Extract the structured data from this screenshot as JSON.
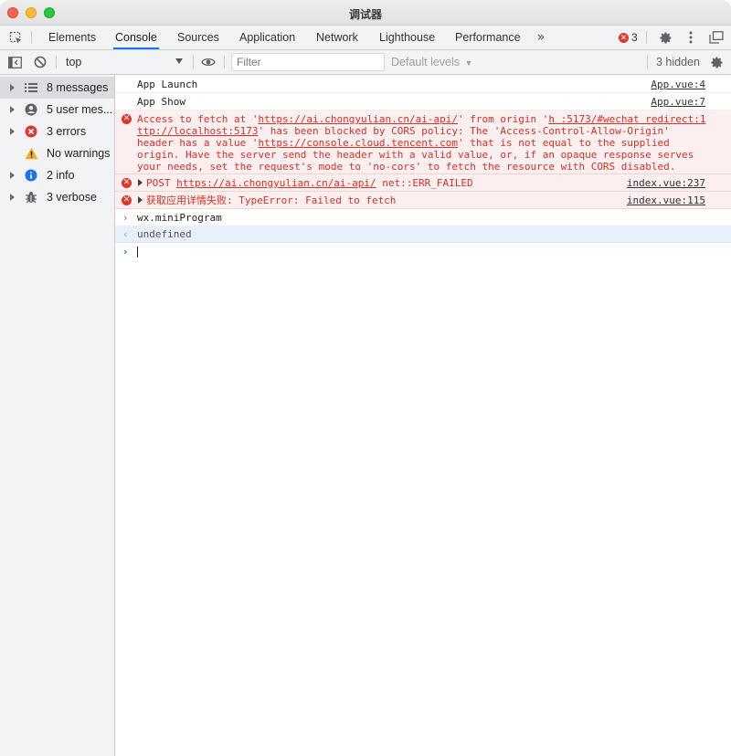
{
  "window": {
    "title": "调试器"
  },
  "tabs": {
    "items": [
      {
        "label": "Elements"
      },
      {
        "label": "Console"
      },
      {
        "label": "Sources"
      },
      {
        "label": "Application"
      },
      {
        "label": "Network"
      },
      {
        "label": "Lighthouse"
      },
      {
        "label": "Performance"
      }
    ],
    "active": "Console",
    "more_icon": "chevron-double-right-icon",
    "error_count": "3"
  },
  "toolbar": {
    "context": "top",
    "filter_placeholder": "Filter",
    "filter_value": "",
    "levels_label": "Default levels",
    "hidden_label": "3 hidden"
  },
  "sidebar": {
    "items": [
      {
        "label": "8 messages",
        "icon": "list-icon",
        "selected": true
      },
      {
        "label": "5 user mes...",
        "icon": "user-icon"
      },
      {
        "label": "3 errors",
        "icon": "error-icon"
      },
      {
        "label": "No warnings",
        "icon": "warning-icon"
      },
      {
        "label": "2 info",
        "icon": "info-icon"
      },
      {
        "label": "3 verbose",
        "icon": "bug-icon"
      }
    ]
  },
  "console": {
    "messages": [
      {
        "text": "App Launch",
        "source": "App.vue:4"
      },
      {
        "text": "App Show",
        "source": "App.vue:7"
      },
      {
        "level": "error",
        "line1_pre": "Access to fetch at '",
        "line1_link": "https://ai.chongyulian.cn/ai-api/",
        "line1_mid": "' from origin '",
        "line1_link2": "h :5173/#wechat redirect:1",
        "line2_link": "ttp://localhost:5173",
        "line2_post": "' has been blocked by CORS policy: The 'Access-Control-Allow-Origin'",
        "line3_pre": "header has a value '",
        "line3_link": "https://console.cloud.tencent.com",
        "line3_post": "' that is not equal to the supplied",
        "line4": "origin. Have the server send the header with a valid value, or, if an opaque response serves",
        "line5": "your needs, set the request's mode to 'no-cors' to fetch the resource with CORS disabled."
      },
      {
        "level": "error",
        "prefix": "POST ",
        "link": "https://ai.chongyulian.cn/ai-api/",
        "suffix": " net::ERR_FAILED",
        "source": "index.vue:237"
      },
      {
        "level": "error",
        "text": "获取应用详情失败: TypeError: Failed to fetch",
        "source": "index.vue:115"
      },
      {
        "type": "input",
        "text": "wx.miniProgram"
      },
      {
        "type": "result",
        "text": "undefined"
      }
    ]
  }
}
